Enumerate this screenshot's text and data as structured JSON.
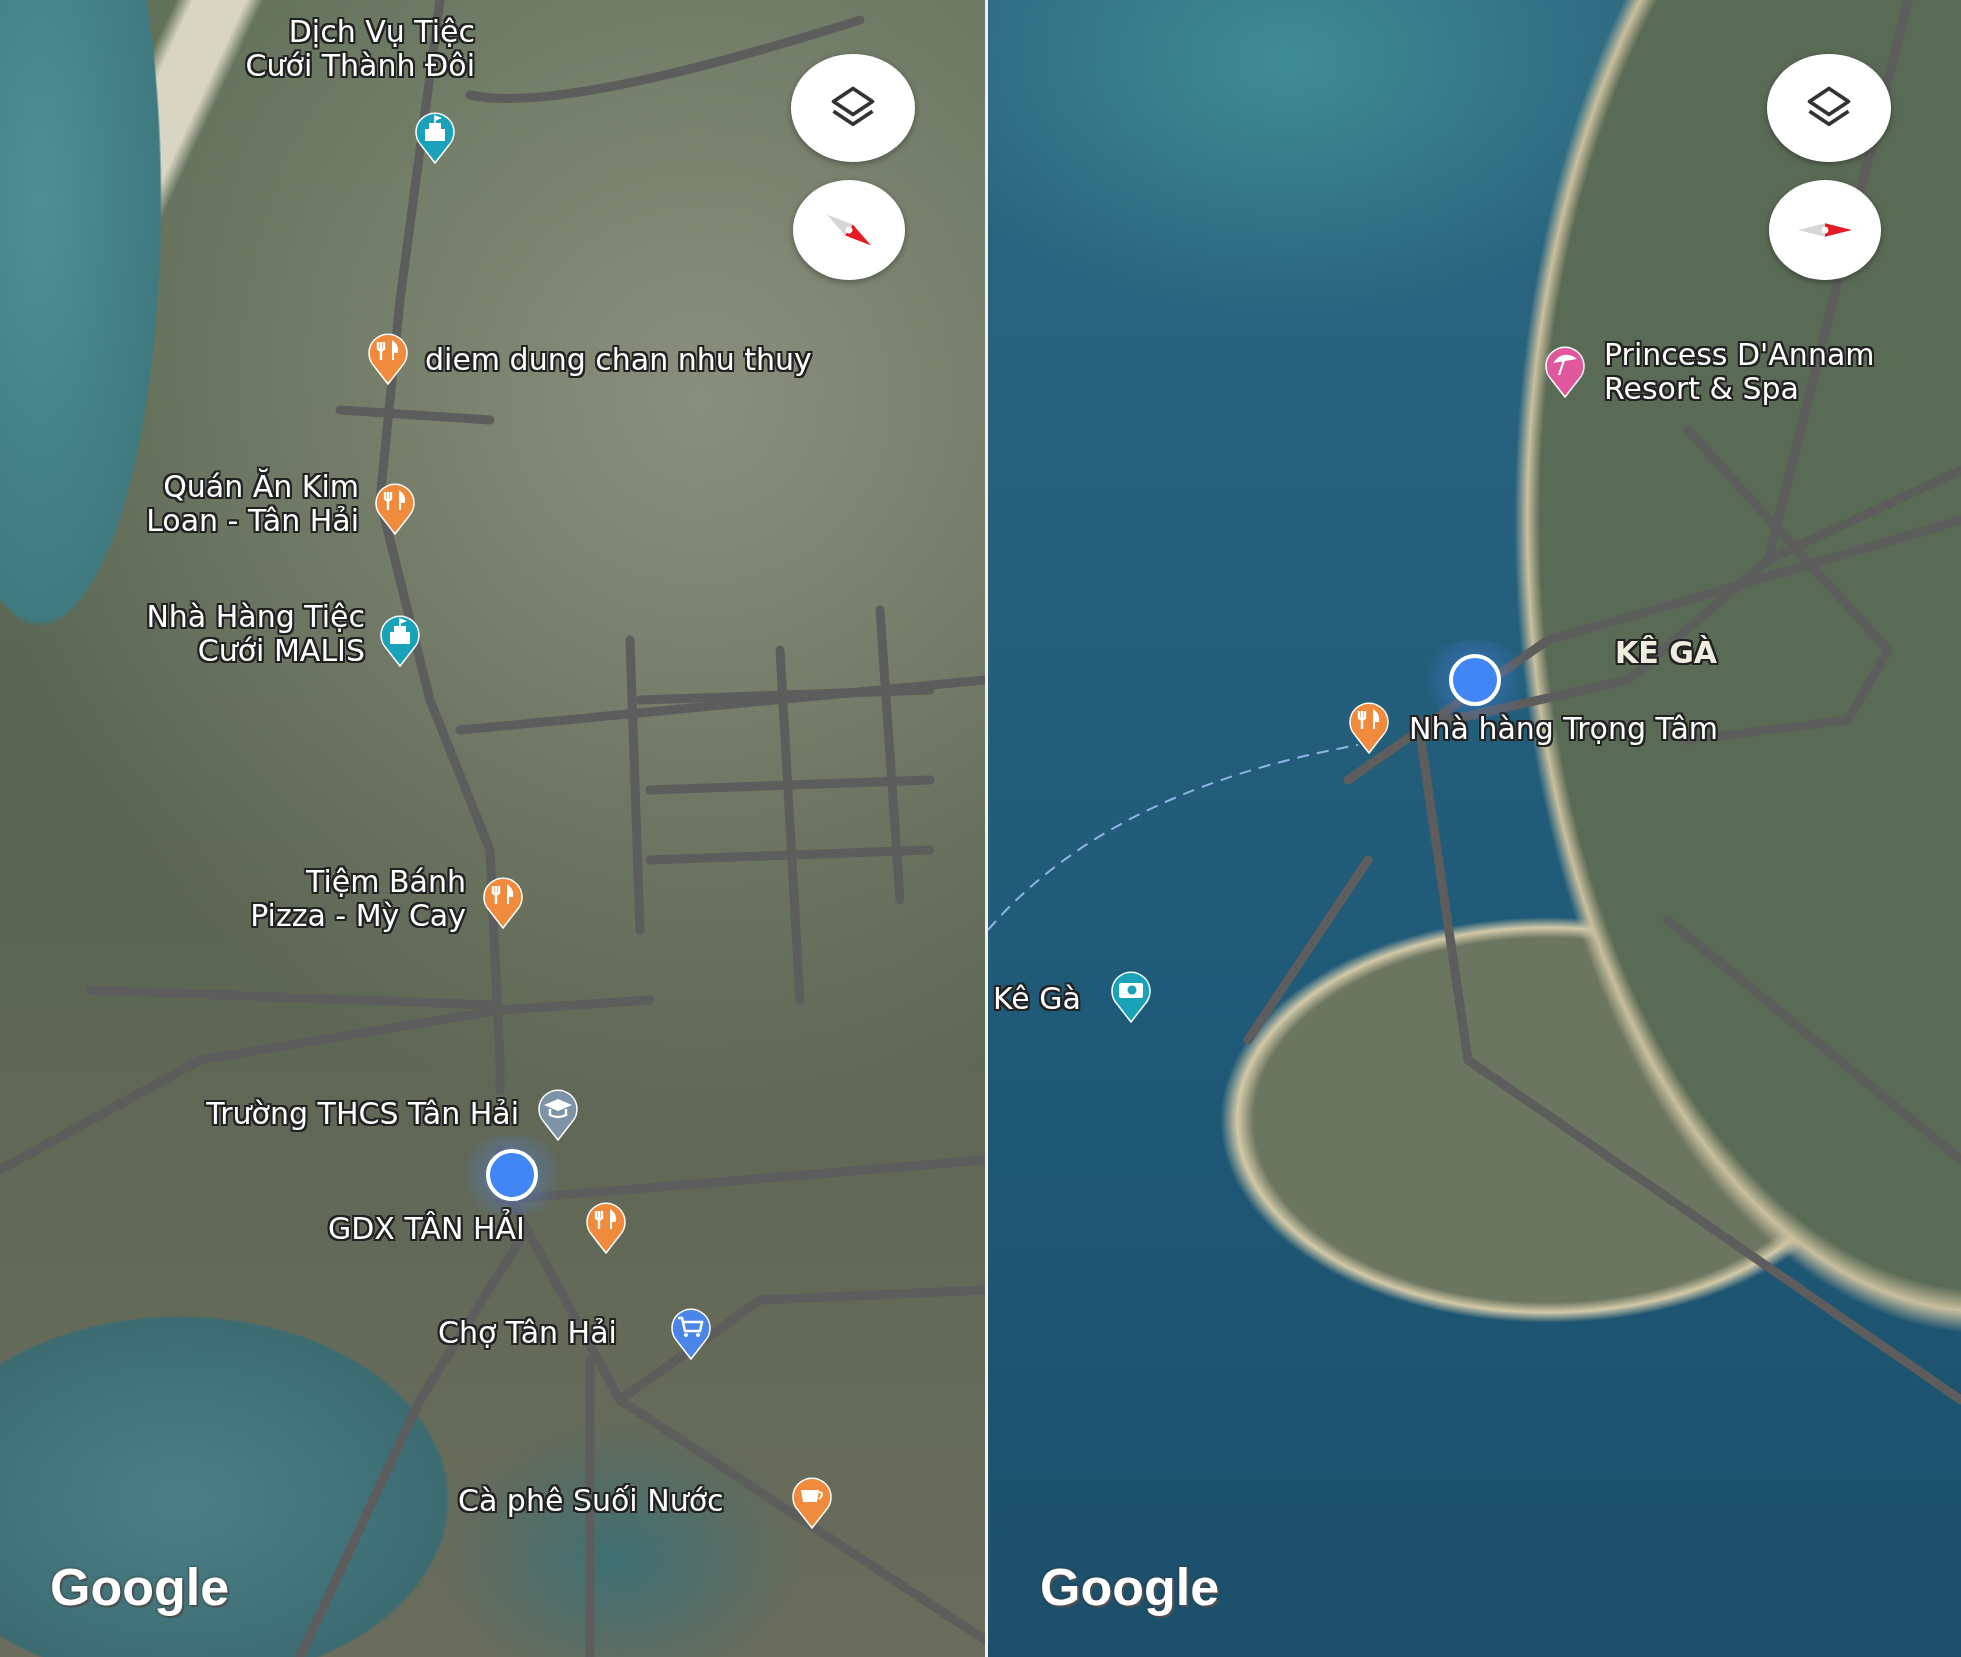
{
  "panels": [
    {
      "places": [
        {
          "lines": [
            "Dịch Vụ Tiệc",
            "Cưới Thành Đôi"
          ],
          "kind": "event",
          "color": "#1aa3b8"
        },
        {
          "lines": [
            "diem dung chan nhu thuy"
          ],
          "kind": "restaurant",
          "color": "#f08a3c"
        },
        {
          "lines": [
            "Quán Ăn Kim",
            "Loan - Tân Hải"
          ],
          "kind": "restaurant",
          "color": "#f08a3c"
        },
        {
          "lines": [
            "Nhà Hàng Tiệc",
            "Cưới MALIS"
          ],
          "kind": "event",
          "color": "#1aa3b8"
        },
        {
          "lines": [
            "Tiệm Bánh",
            "Pizza - Mỳ Cay"
          ],
          "kind": "restaurant",
          "color": "#f08a3c"
        },
        {
          "lines": [
            "Trường THCS Tân Hải"
          ],
          "kind": "school",
          "color": "#7d93a8"
        },
        {
          "lines": [
            "GDX TÂN HẢI"
          ],
          "kind": "restaurant",
          "color": "#f08a3c"
        },
        {
          "lines": [
            "Chợ Tân Hải"
          ],
          "kind": "shopping",
          "color": "#4a86e8"
        },
        {
          "lines": [
            "Cà phê Suối Nước"
          ],
          "kind": "cafe",
          "color": "#f08a3c"
        }
      ],
      "logo": "Google"
    },
    {
      "places": [
        {
          "lines": [
            "Princess D'Annam",
            "Resort & Spa"
          ],
          "kind": "resort",
          "color": "#e0579d"
        },
        {
          "lines": [
            "KÊ GÀ"
          ],
          "kind": "area"
        },
        {
          "lines": [
            "Nhà hàng Trọng Tâm"
          ],
          "kind": "restaurant",
          "color": "#f08a3c"
        },
        {
          "lines": [
            "Kê Gà"
          ],
          "kind": "camera",
          "color": "#1aa3b8"
        }
      ],
      "logo": "Google"
    }
  ]
}
